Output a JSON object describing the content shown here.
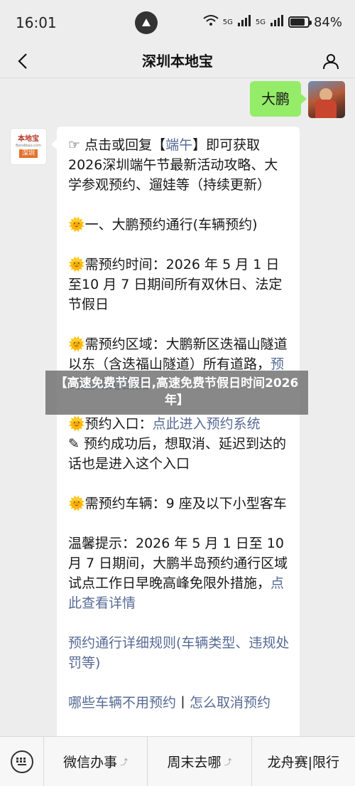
{
  "status": {
    "time": "16:01",
    "network": "5G",
    "battery": "84%",
    "battery_level": 0.84
  },
  "nav": {
    "title": "深圳本地宝",
    "back_icon": "chevron-left-icon",
    "profile_icon": "user-icon"
  },
  "user_message": {
    "text": "大鹏"
  },
  "bot_avatar": {
    "logo_top": "本地宝",
    "logo_mid": "Bendibao.com",
    "logo_bottom": "深圳"
  },
  "bot_message": {
    "intro_prefix": "☞ 点击或回复【",
    "intro_link": "端午",
    "intro_suffix": "】即可获取2026深圳端午节最新活动攻略、大学参观预约、遛娃等（持续更新）",
    "section_title": "🌞一、大鹏预约通行(车辆预约)",
    "time_label": "🌞需预约时间：2026 年 5 月 1 日至10 月 7 日期间所有双休日、法定节假日",
    "area_label_prefix": "🌞需预约区域：大鹏新区迭福山隧道以东（含迭福山隧道）所有道路，",
    "area_link": "预约区域范围图",
    "entry_prefix": "🌞预约入口：",
    "entry_link": "点此进入预约系统",
    "entry_note": "✎ 预约成功后，想取消、延迟到达的话也是进入这个入口",
    "vehicle_label": "🌞需预约车辆：9 座及以下小型客车",
    "tip_prefix": "温馨提示：2026 年 5 月 1 日至 10 月 7 日期间，大鹏半岛预约通行区域试点工作日早晚高峰免限外措施，",
    "tip_link": "点此查看详情",
    "rules_link": "预约通行详细规则(车辆类型、违规处罚等)",
    "bottom_link_1": "哪些车辆不用预约",
    "bottom_sep": "丨",
    "bottom_link_2": "怎么取消预约"
  },
  "caption": {
    "text": "【高速免费节假日,高速免费节假日时间2026年】"
  },
  "bottom_menu": {
    "keyboard_icon": "keyboard-icon",
    "items": [
      {
        "label": "微信办事"
      },
      {
        "label": "周末去哪"
      },
      {
        "label": "龙舟赛|限行"
      }
    ]
  },
  "colors": {
    "user_bubble": "#95ec69",
    "link": "#576b95",
    "background": "#ededed"
  }
}
